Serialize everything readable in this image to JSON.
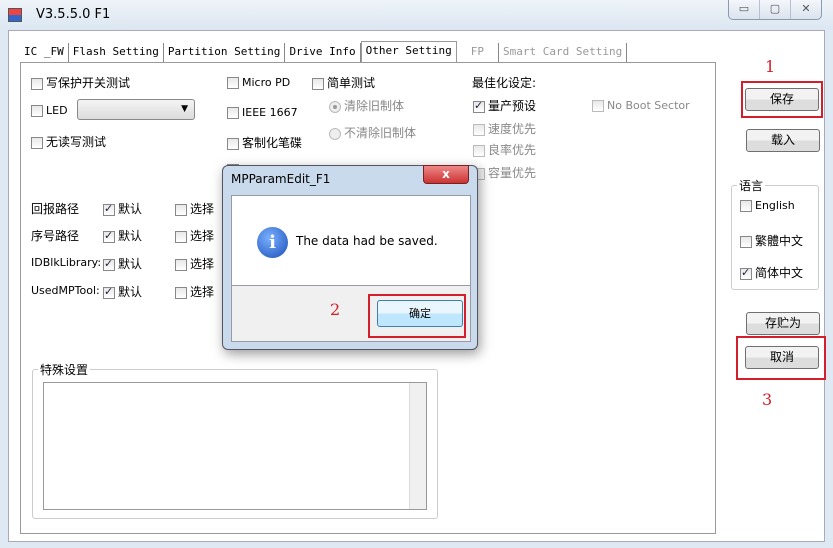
{
  "window": {
    "title": "V3.5.5.0 F1",
    "controls": [
      "▭",
      "▢",
      "✕"
    ]
  },
  "tabs": [
    {
      "label": "IC _FW",
      "state": "normal"
    },
    {
      "label": "Flash Setting",
      "state": "normal"
    },
    {
      "label": "Partition Setting",
      "state": "normal"
    },
    {
      "label": "Drive Info",
      "state": "normal"
    },
    {
      "label": "Other Setting",
      "state": "active"
    },
    {
      "label": "FP",
      "state": "disabled"
    },
    {
      "label": "Smart Card Setting",
      "state": "disabled"
    }
  ],
  "options": {
    "write_protect": {
      "label": "写保护开关测试",
      "checked": false
    },
    "led": {
      "label": "LED",
      "checked": false,
      "combo_value": ""
    },
    "no_rw_test": {
      "label": "无读写测试",
      "checked": false
    },
    "micro_pd": {
      "label": "Micro PD",
      "checked": false
    },
    "ieee1667": {
      "label": "IEEE 1667",
      "checked": false
    },
    "custom_disk": {
      "label": "客制化笔碟",
      "checked": false
    },
    "simple_test": {
      "label": "简单测试",
      "checked": false
    },
    "clear_fw": {
      "label": "清除旧制体",
      "selected": true
    },
    "no_clear_fw": {
      "label": "不清除旧制体",
      "selected": false
    },
    "optimize_title": "最佳化设定:",
    "mp_default": {
      "label": "量产预设",
      "checked": true
    },
    "speed_first": {
      "label": "速度优先",
      "checked": false
    },
    "yield_first": {
      "label": "良率优先",
      "checked": false
    },
    "capacity_first": {
      "label": "容量优先",
      "checked": false
    },
    "no_boot_sector": {
      "label": "No Boot Sector",
      "checked": false
    }
  },
  "paths": [
    {
      "label": "回报路径",
      "default_label": "默认",
      "default_checked": true,
      "select_label": "选择",
      "select_checked": false
    },
    {
      "label": "序号路径",
      "default_label": "默认",
      "default_checked": true,
      "select_label": "选择",
      "select_checked": false
    },
    {
      "label": "IDBlkLibrary:",
      "default_label": "默认",
      "default_checked": true,
      "select_label": "选择",
      "select_checked": false
    },
    {
      "label": "UsedMPTool:",
      "default_label": "默认",
      "default_checked": true,
      "select_label": "选择",
      "select_checked": false
    }
  ],
  "special": {
    "title": "特殊设置",
    "value": ""
  },
  "side": {
    "save": "保存",
    "load": "载入",
    "save_as": "存贮为",
    "cancel": "取消",
    "lang_title": "语言",
    "langs": [
      {
        "label": "English",
        "checked": false
      },
      {
        "label": "繁體中文",
        "checked": false
      },
      {
        "label": "简体中文",
        "checked": true
      }
    ]
  },
  "annotations": [
    "1",
    "2",
    "3"
  ],
  "dialog": {
    "title": "MPParamEdit_F1",
    "close": "x",
    "icon": "information-icon",
    "message": "The data had be saved.",
    "ok": "确定"
  },
  "colors": {
    "annotation_red": "#d21f2b"
  }
}
